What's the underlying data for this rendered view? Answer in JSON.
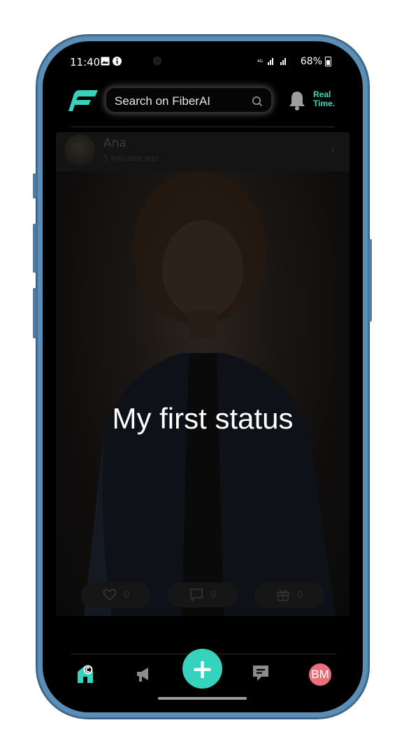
{
  "status_bar": {
    "time": "11:40",
    "battery": "68%",
    "signal": "☃ 4G .ıl ᴿıl"
  },
  "header": {
    "search_placeholder": "Search on FiberAI",
    "realtime_line1": "Real",
    "realtime_line2": "Time."
  },
  "post": {
    "author": "Ana",
    "time_ago": "5 minutes ago",
    "status_text": "My first status",
    "likes": "0",
    "comments": "0",
    "gifts": "0"
  },
  "nav": {
    "profile_initials": "BM"
  },
  "colors": {
    "accent": "#36d2bd",
    "avatar_bg": "#e96f7a",
    "background": "#000000"
  }
}
